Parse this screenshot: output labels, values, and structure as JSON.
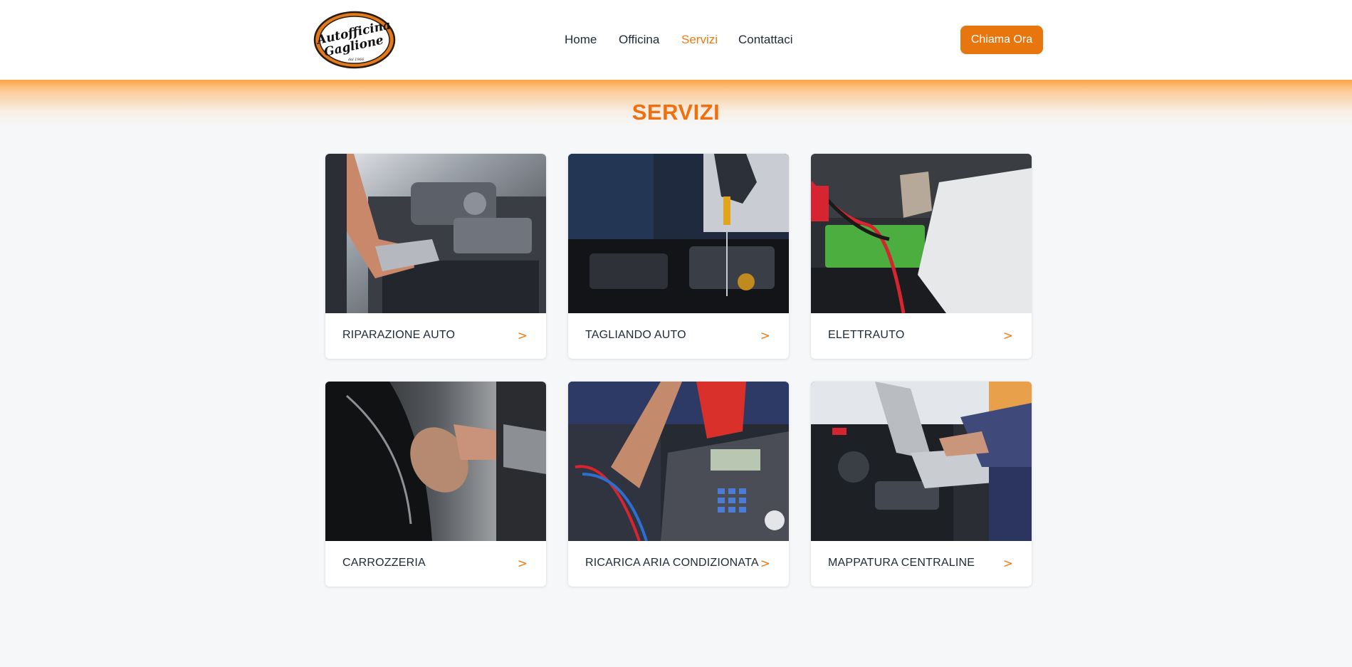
{
  "header": {
    "logo": {
      "line1": "Autofficina",
      "line2": "Gaglione",
      "since": "dal 1966"
    },
    "nav": [
      {
        "label": "Home",
        "active": false
      },
      {
        "label": "Officina",
        "active": false
      },
      {
        "label": "Servizi",
        "active": true
      },
      {
        "label": "Contattaci",
        "active": false
      }
    ],
    "cta_label": "Chiama Ora"
  },
  "colors": {
    "accent": "#f07a12",
    "button": "#e8760f",
    "text": "#1f2a37",
    "background": "#f6f7f9"
  },
  "main": {
    "title": "SERVIZI",
    "arrow": ">",
    "cards": [
      {
        "label": "RIPARAZIONE AUTO",
        "image": "engine-repair-photo"
      },
      {
        "label": "TAGLIANDO AUTO",
        "image": "oil-dipstick-photo"
      },
      {
        "label": "ELETTRAUTO",
        "image": "jumper-cables-photo"
      },
      {
        "label": "CARROZZERIA",
        "image": "car-polishing-photo"
      },
      {
        "label": "RICARICA ARIA CONDIZIONATA",
        "image": "ac-recharge-photo"
      },
      {
        "label": "MAPPATURA CENTRALINE",
        "image": "ecu-laptop-photo"
      }
    ]
  }
}
